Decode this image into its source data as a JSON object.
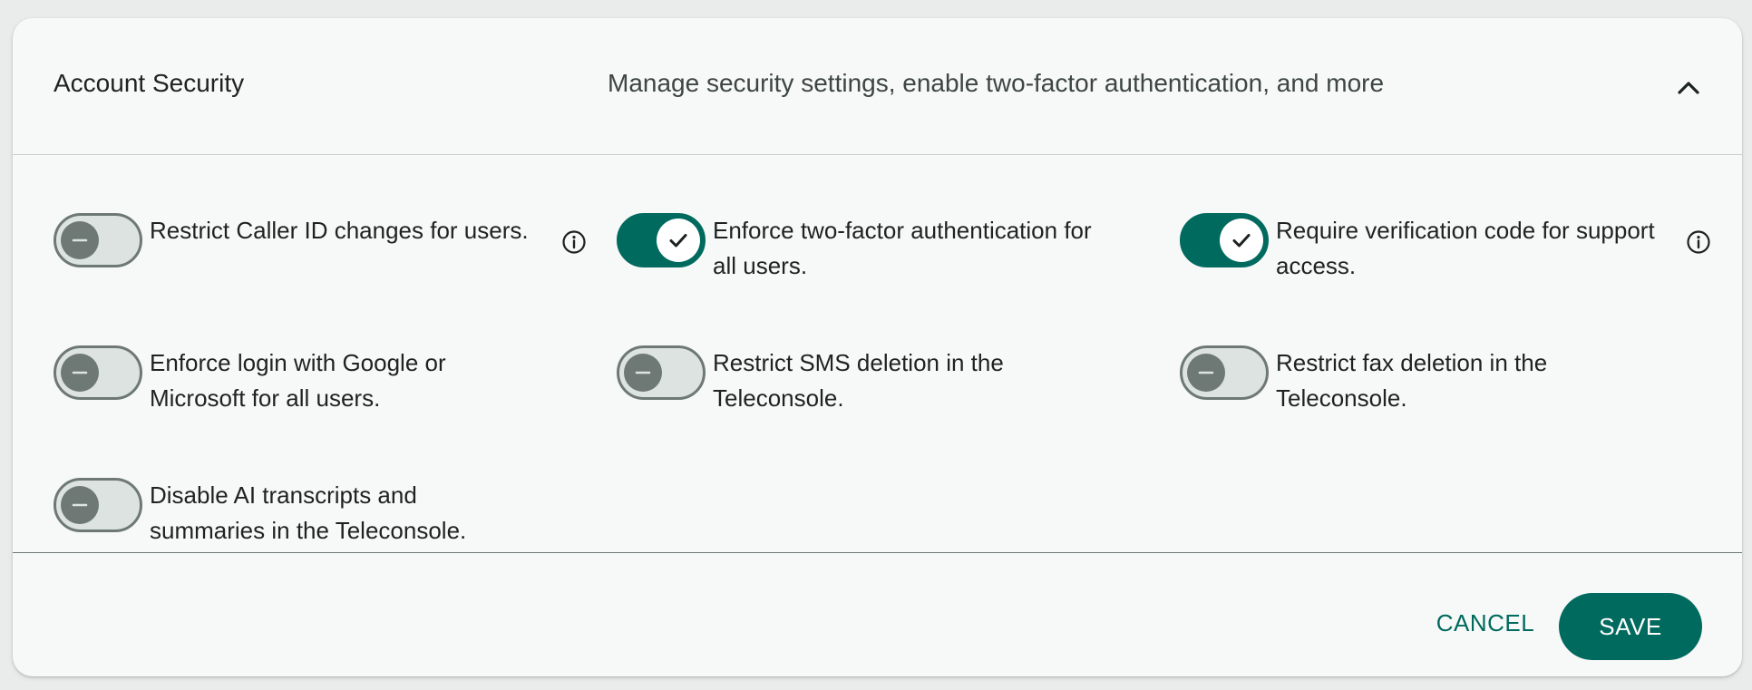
{
  "colors": {
    "accent": "#006a5e",
    "toggle_off_track": "#dce3e0",
    "toggle_off_outline": "#6e7874",
    "text_primary": "#1d2321",
    "text_secondary": "#3d4643",
    "page_background": "#e9ecea",
    "card_background": "#f7f9f8"
  },
  "header": {
    "title": "Account Security",
    "subtitle": "Manage security settings, enable two-factor authentication, and more",
    "collapse_icon": "chevron-up-icon"
  },
  "settings": [
    {
      "label": "Restrict Caller ID changes for users.",
      "enabled": false,
      "has_info": true
    },
    {
      "label": "Enforce two-factor authentication for all users.",
      "enabled": true,
      "has_info": false
    },
    {
      "label": "Require verification code for support access.",
      "enabled": true,
      "has_info": true
    },
    {
      "label": "Enforce login with Google or Microsoft for all users.",
      "enabled": false,
      "has_info": false
    },
    {
      "label": "Restrict SMS deletion in the Teleconsole.",
      "enabled": false,
      "has_info": false
    },
    {
      "label": "Restrict fax deletion in the Teleconsole.",
      "enabled": false,
      "has_info": false
    },
    {
      "label": "Disable AI transcripts and summaries in the Teleconsole.",
      "enabled": false,
      "has_info": false
    }
  ],
  "footer": {
    "cancel_label": "CANCEL",
    "save_label": "SAVE"
  }
}
